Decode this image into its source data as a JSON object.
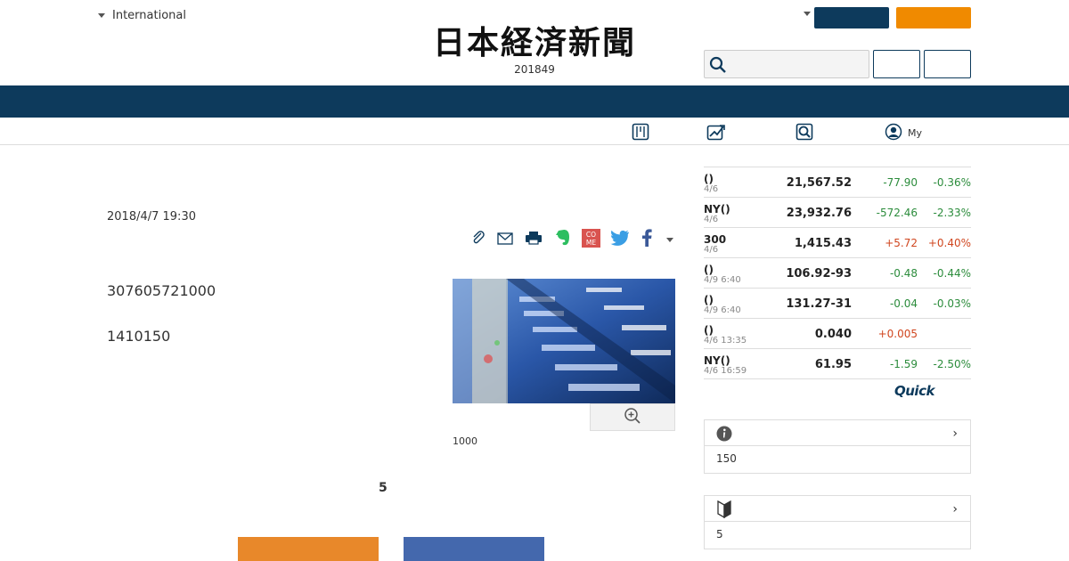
{
  "header": {
    "international_label": "International",
    "logo_text": "日本経済新聞",
    "logo_sub": "201849"
  },
  "article": {
    "date": "2018/4/7 19:30",
    "paragraphs": [
      "307605721000",
      "1410150"
    ],
    "photo_caption": "1000",
    "subhead": "5"
  },
  "subnav": {
    "my_label": "My"
  },
  "market": {
    "rows": [
      {
        "name": "()",
        "sub": "4/6",
        "value": "21,567.52",
        "change": "-77.90",
        "pct": "-0.36%",
        "dir": "neg"
      },
      {
        "name": "NY()",
        "sub": "4/6",
        "value": "23,932.76",
        "change": "-572.46",
        "pct": "-2.33%",
        "dir": "neg"
      },
      {
        "name": "300",
        "sub": "4/6",
        "value": "1,415.43",
        "change": "+5.72",
        "pct": "+0.40%",
        "dir": "pos"
      },
      {
        "name": "()",
        "sub": "4/9 6:40",
        "value": "106.92-93",
        "change": "-0.48",
        "pct": "-0.44%",
        "dir": "neg"
      },
      {
        "name": "()",
        "sub": "4/9 6:40",
        "value": "131.27-31",
        "change": "-0.04",
        "pct": "-0.03%",
        "dir": "neg"
      },
      {
        "name": "()",
        "sub": "4/6 13:35",
        "value": "0.040",
        "change": "+0.005",
        "pct": "",
        "dir": "pos"
      },
      {
        "name": "NY()",
        "sub": "4/6 16:59",
        "value": "61.95",
        "change": "-1.59",
        "pct": "-2.50%",
        "dir": "neg"
      }
    ],
    "quick_logo": "Quick"
  },
  "cards": {
    "info": {
      "value": "150"
    },
    "beginner": {
      "value": "5"
    }
  },
  "colors": {
    "navy": "#0d3a5c",
    "orange": "#f08a00",
    "negative": "#2c8c3c",
    "positive": "#d0461f"
  }
}
